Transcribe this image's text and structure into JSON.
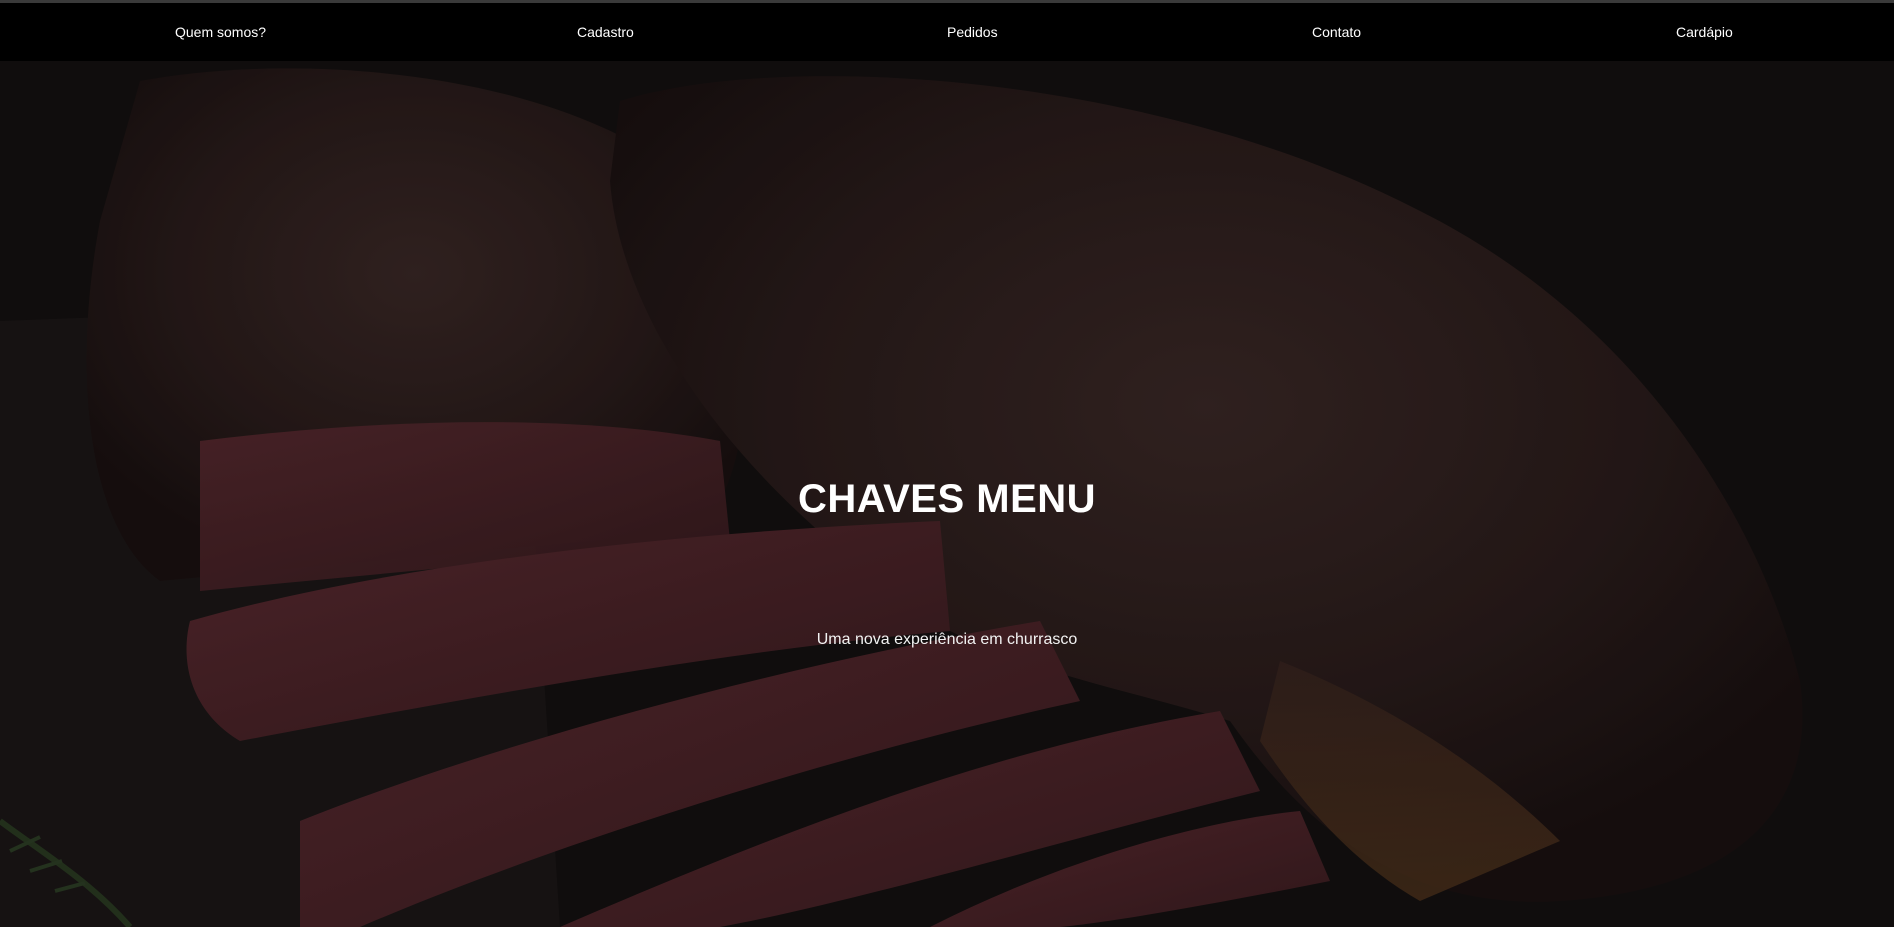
{
  "nav": {
    "items": [
      {
        "label": "Quem somos?"
      },
      {
        "label": "Cadastro"
      },
      {
        "label": "Pedidos"
      },
      {
        "label": "Contato"
      },
      {
        "label": "Cardápio"
      }
    ]
  },
  "hero": {
    "title": "CHAVES MENU",
    "subtitle": "Uma nova experiência em churrasco",
    "image": "grilled-steak-photo"
  },
  "colors": {
    "navbar": "#000000",
    "text": "#ffffff",
    "hero_tint": "#1a1414"
  }
}
